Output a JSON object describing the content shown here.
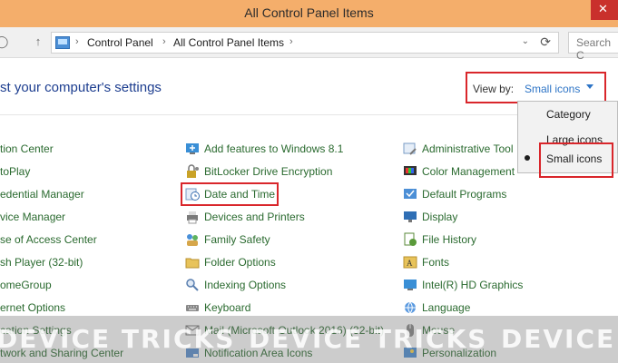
{
  "window": {
    "title": "All Control Panel Items",
    "close_glyph": "✕"
  },
  "nav": {
    "back_glyph": "◯",
    "up_glyph": "↑",
    "breadcrumb": [
      "Control Panel",
      "All Control Panel Items"
    ],
    "separator": "›",
    "dropdown_glyph": "⌄",
    "refresh_glyph": "⟳",
    "search_placeholder": "Search C"
  },
  "main": {
    "heading": "st your computer's settings",
    "view_by": {
      "label": "View by:",
      "value": "Small icons"
    },
    "view_menu": {
      "options": [
        "Category",
        "Large icons",
        "Small icons"
      ],
      "selected": "Small icons"
    }
  },
  "items": {
    "col1": [
      "tion Center",
      "toPlay",
      "edential Manager",
      "vice Manager",
      "se of Access Center",
      "sh Player (32-bit)",
      "omeGroup",
      "ernet Options",
      "cation Settings",
      "twork and Sharing Center"
    ],
    "col2": [
      "Add features to Windows 8.1",
      "BitLocker Drive Encryption",
      "Date and Time",
      "Devices and Printers",
      "Family Safety",
      "Folder Options",
      "Indexing Options",
      "Keyboard",
      "Mail (Microsoft Outlook 2016) (32-bit)",
      "Notification Area Icons"
    ],
    "col3": [
      "Administrative Tool",
      "Color Management",
      "Default Programs",
      "Display",
      "File History",
      "Fonts",
      "Intel(R) HD Graphics",
      "Language",
      "Mouse",
      "Personalization"
    ]
  },
  "watermark": [
    "DEVICE TRICKS",
    "DEVICE TRICKS",
    "DEVICE"
  ],
  "colors": {
    "link": "#2a6a2f",
    "accent": "#2d74c6",
    "highlight": "#d9262b",
    "titlebar": "#f4ae6b"
  }
}
